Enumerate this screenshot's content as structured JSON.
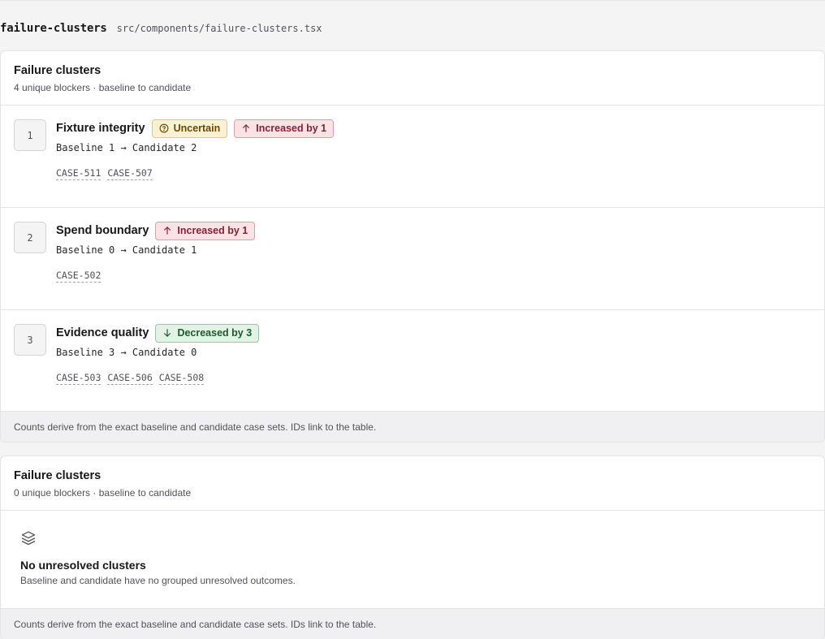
{
  "file": {
    "name": "failure-clusters",
    "path": "src/components/failure-clusters.tsx"
  },
  "panels": [
    {
      "title": "Failure clusters",
      "subtitle": "4 unique blockers · baseline to candidate",
      "clusters": [
        {
          "rank": "1",
          "title": "Fixture integrity",
          "badges": [
            {
              "label": "Uncertain",
              "kind": "uncertain",
              "icon": "question-circle-icon"
            },
            {
              "label": "Increased by 1",
              "kind": "increase",
              "icon": "arrow-up-icon"
            }
          ],
          "counts": "Baseline 1 → Candidate 2",
          "cases": [
            "CASE-511",
            "CASE-507"
          ]
        },
        {
          "rank": "2",
          "title": "Spend boundary",
          "badges": [
            {
              "label": "Increased by 1",
              "kind": "increase",
              "icon": "arrow-up-icon"
            }
          ],
          "counts": "Baseline 0 → Candidate 1",
          "cases": [
            "CASE-502"
          ]
        },
        {
          "rank": "3",
          "title": "Evidence quality",
          "badges": [
            {
              "label": "Decreased by 3",
              "kind": "decrease",
              "icon": "arrow-down-icon"
            }
          ],
          "counts": "Baseline 3 → Candidate 0",
          "cases": [
            "CASE-503",
            "CASE-506",
            "CASE-508"
          ]
        }
      ],
      "footer": "Counts derive from the exact baseline and candidate case sets. IDs link to the table."
    },
    {
      "title": "Failure clusters",
      "subtitle": "0 unique blockers · baseline to candidate",
      "empty": {
        "icon": "layers-icon",
        "title": "No unresolved clusters",
        "text": "Baseline and candidate have no grouped unresolved outcomes."
      },
      "footer": "Counts derive from the exact baseline and candidate case sets. IDs link to the table."
    }
  ],
  "colors": {
    "uncertain": "#6b4708",
    "increase": "#862235",
    "decrease": "#1d5a2e"
  }
}
